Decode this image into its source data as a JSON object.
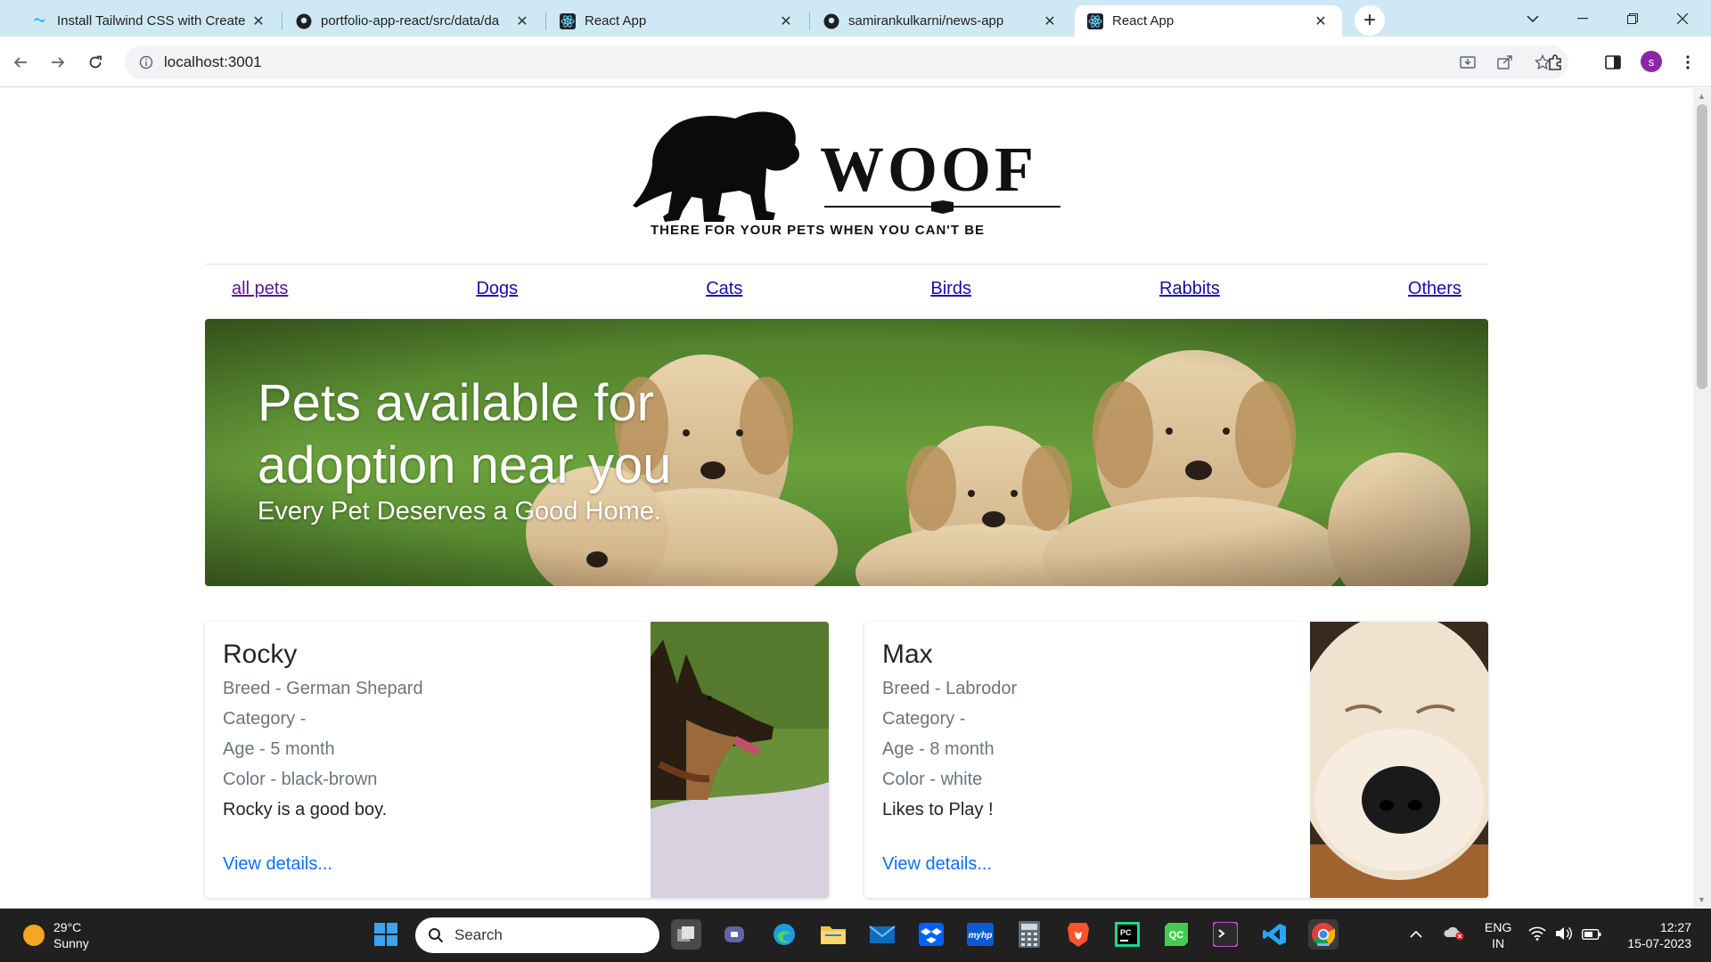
{
  "browser": {
    "tabs": [
      {
        "title": "Install Tailwind CSS with Create",
        "favicon": "tailwind-icon",
        "active": false
      },
      {
        "title": "portfolio-app-react/src/data/da",
        "favicon": "github-icon",
        "active": false
      },
      {
        "title": "React App",
        "favicon": "react-icon",
        "active": false
      },
      {
        "title": "samirankulkarni/news-app",
        "favicon": "github-icon",
        "active": false
      },
      {
        "title": "React App",
        "favicon": "react-icon",
        "active": true
      }
    ],
    "url": "localhost:3001",
    "profile_initial": "s",
    "colors": {
      "tabstrip": "#cfe9f4",
      "profile": "#8e24aa"
    }
  },
  "site": {
    "logo_word": "WOOF",
    "logo_tagline": "THERE FOR YOUR PETS WHEN YOU CAN'T BE",
    "nav": [
      {
        "label": "all pets",
        "visited": true
      },
      {
        "label": "Dogs",
        "visited": false
      },
      {
        "label": "Cats",
        "visited": false
      },
      {
        "label": "Birds",
        "visited": false
      },
      {
        "label": "Rabbits",
        "visited": false
      },
      {
        "label": "Others",
        "visited": false
      }
    ],
    "hero": {
      "title": "Pets available for adoption near you",
      "subtitle": "Every Pet Deserves a Good Home."
    },
    "pets": [
      {
        "name": "Rocky",
        "breed": "Breed - German Shepard",
        "category": "Category -",
        "age": "Age - 5 month",
        "color": "Color - black-brown",
        "description": "Rocky is a good boy.",
        "details_link": "View details..."
      },
      {
        "name": "Max",
        "breed": "Breed - Labrodor",
        "category": "Category -",
        "age": "Age - 8 month",
        "color": "Color - white",
        "description": "Likes to Play !",
        "details_link": "View details..."
      }
    ],
    "colors": {
      "link": "#0d6efd",
      "nav_link": "#1a0dab",
      "nav_visited": "#551a8b"
    }
  },
  "taskbar": {
    "weather_temp": "29°C",
    "weather_desc": "Sunny",
    "search_label": "Search",
    "language": "ENG",
    "region": "IN",
    "time": "12:27",
    "date": "15-07-2023"
  }
}
